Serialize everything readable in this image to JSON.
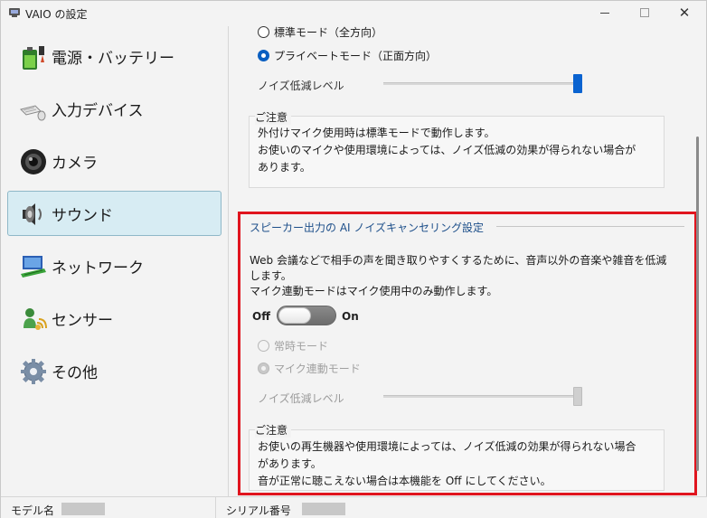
{
  "window": {
    "title": "VAIO の設定",
    "minimize_icon": "minimize-icon",
    "maximize_icon": "maximize-icon",
    "close_icon": "close-icon",
    "close_glyph": "✕"
  },
  "sidebar": {
    "items": [
      {
        "label": "電源・バッテリー",
        "icon": "battery-icon",
        "active": false
      },
      {
        "label": "入力デバイス",
        "icon": "keyboard-mouse-icon",
        "active": false
      },
      {
        "label": "カメラ",
        "icon": "camera-icon",
        "active": false
      },
      {
        "label": "サウンド",
        "icon": "speaker-icon",
        "active": true
      },
      {
        "label": "ネットワーク",
        "icon": "network-icon",
        "active": false
      },
      {
        "label": "センサー",
        "icon": "sensor-icon",
        "active": false
      },
      {
        "label": "その他",
        "icon": "gear-icon",
        "active": false
      }
    ]
  },
  "mic": {
    "mode_standard": "標準モード（全方向）",
    "mode_private": "プライベートモード（正面方向）",
    "selected_mode": "private",
    "noise_label": "ノイズ低減レベル",
    "noise_level_fraction": 1.0,
    "note_title": "ご注意",
    "note_lines": [
      "外付けマイク使用時は標準モードで動作します。",
      "お使いのマイクや使用環境によっては、ノイズ低減の効果が得られない場合が",
      "あります。"
    ]
  },
  "speaker_ai": {
    "title": "スピーカー出力の AI ノイズキャンセリング設定",
    "description_lines": [
      "Web 会議などで相手の声を聞き取りやすくするために、音声以外の音楽や雑音を低減",
      "します。",
      "マイク連動モードはマイク使用中のみ動作します。"
    ],
    "toggle_off_label": "Off",
    "toggle_on_label": "On",
    "toggle_state": "off",
    "mode_always": "常時モード",
    "mode_mic_linked": "マイク連動モード",
    "selected_mode": "mic_linked",
    "noise_label": "ノイズ低減レベル",
    "noise_level_fraction": 1.0,
    "note_title": "ご注意",
    "note_lines": [
      "お使いの再生機器や使用環境によっては、ノイズ低減の効果が得られない場合",
      "があります。",
      "音が正常に聴こえない場合は本機能を Off にしてください。"
    ]
  },
  "status": {
    "model_label": "モデル名",
    "serial_label": "シリアル番号"
  },
  "colors": {
    "accent": "#0a63d0",
    "highlight_border": "#e0141e",
    "active_nav_bg": "#d7ecf3",
    "section_title": "#1d4f8a"
  }
}
